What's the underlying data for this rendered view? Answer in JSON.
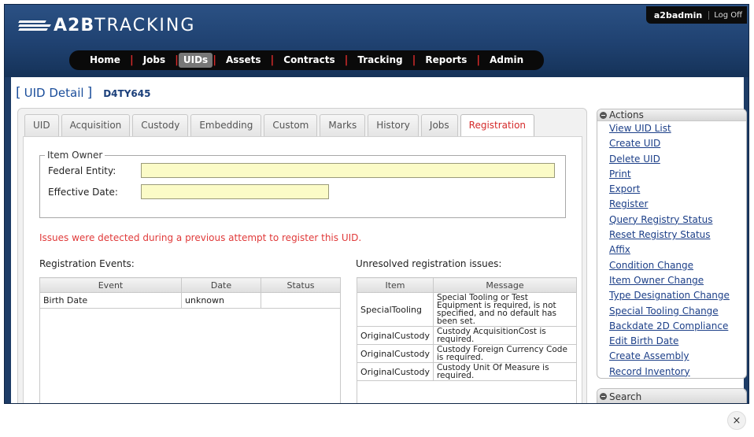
{
  "app": {
    "logo_bold": "A2B",
    "logo_thin": "TRACKING",
    "user": "a2badmin",
    "logoff": "Log Off"
  },
  "nav": [
    "Home",
    "Jobs",
    "UIDs",
    "Assets",
    "Contracts",
    "Tracking",
    "Reports",
    "Admin"
  ],
  "nav_active": "UIDs",
  "page": {
    "title_open": "[",
    "title": "UID Detail",
    "title_close": "]",
    "uid": "D4TY645"
  },
  "tabs": [
    "UID",
    "Acquisition",
    "Custody",
    "Embedding",
    "Custom",
    "Marks",
    "History",
    "Jobs",
    "Registration"
  ],
  "active_tab": "Registration",
  "owner": {
    "legend": "Item Owner",
    "federal_entity_label": "Federal Entity:",
    "federal_entity_value": "",
    "effective_date_label": "Effective Date:",
    "effective_date_value": ""
  },
  "warning": "Issues were detected during a previous attempt to register this UID.",
  "events": {
    "label": "Registration Events:",
    "columns": [
      "Event",
      "Date",
      "Status"
    ],
    "rows": [
      [
        "Birth Date",
        "unknown",
        ""
      ]
    ]
  },
  "issues": {
    "label": "Unresolved registration issues:",
    "columns": [
      "Item",
      "Message"
    ],
    "rows": [
      [
        "SpecialTooling",
        "Special Tooling or Test Equipment is required, is not specified, and no default has been set."
      ],
      [
        "OriginalCustody",
        "Custody AcquisitionCost is required."
      ],
      [
        "OriginalCustody",
        "Custody Foreign Currency Code is required."
      ],
      [
        "OriginalCustody",
        "Custody Unit Of Measure is required."
      ]
    ]
  },
  "actions": {
    "title": "Actions",
    "items": [
      "View UID List",
      "Create UID",
      "Delete UID",
      "Print",
      "Export",
      "Register",
      "Query Registry Status",
      "Reset Registry Status",
      "Affix",
      "Condition Change",
      "Item Owner Change",
      "Type Designation Change",
      "Special Tooling Change",
      "Backdate 2D Compliance",
      "Edit Birth Date",
      "Create Assembly",
      "Record Inventory"
    ]
  },
  "search": {
    "title": "Search"
  },
  "close": "×"
}
